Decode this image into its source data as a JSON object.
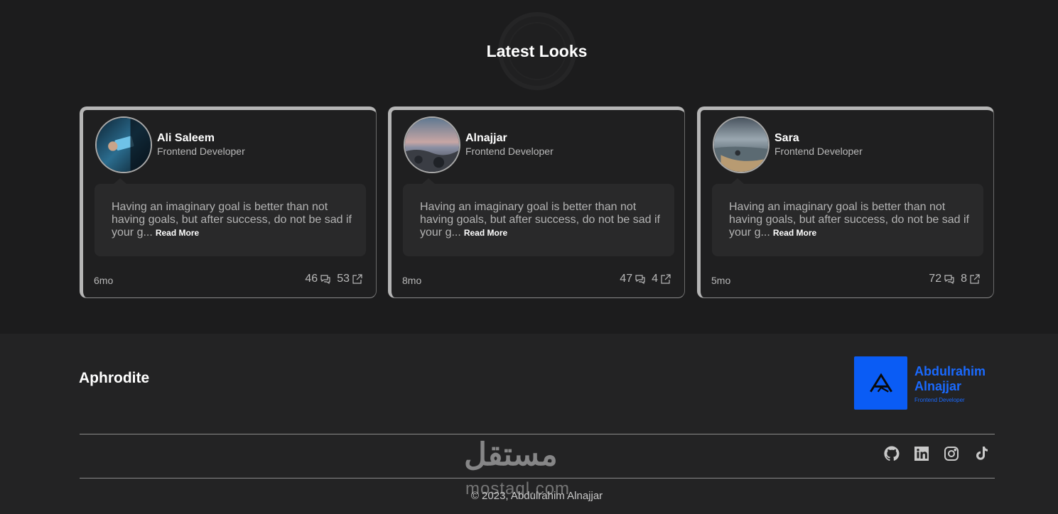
{
  "section": {
    "title": "Latest Looks"
  },
  "cards": [
    {
      "name": "Ali Saleem",
      "role": "Frontend Developer",
      "quote": "Having an imaginary goal is better than not having goals, but after success, do not be sad if your g...",
      "read_more": "Read More",
      "age": "6mo",
      "comments": "46",
      "shares": "53"
    },
    {
      "name": "Alnajjar",
      "role": "Frontend Developer",
      "quote": "Having an imaginary goal is better than not having goals, but after success, do not be sad if your g...",
      "read_more": "Read More",
      "age": "8mo",
      "comments": "47",
      "shares": "4"
    },
    {
      "name": "Sara",
      "role": "Frontend Developer",
      "quote": "Having an imaginary goal is better than not having goals, but after success, do not be sad if your g...",
      "read_more": "Read More",
      "age": "5mo",
      "comments": "72",
      "shares": "8"
    }
  ],
  "footer": {
    "brand": "Aphrodite",
    "logo_name": "Abdulrahim Alnajjar",
    "logo_sub": "Frontend Developer",
    "socials": [
      "github-icon",
      "linkedin-icon",
      "instagram-icon",
      "tiktok-icon"
    ],
    "copyright": "© 2023, Abdulrahim Alnajjar",
    "watermark": "مستقل",
    "watermark_sub": "mostaql.com"
  },
  "colors": {
    "background": "#1c1c1d",
    "footer": "#232324",
    "accent_blue": "#0a5cf5",
    "card_border": "#b5b5b5"
  }
}
